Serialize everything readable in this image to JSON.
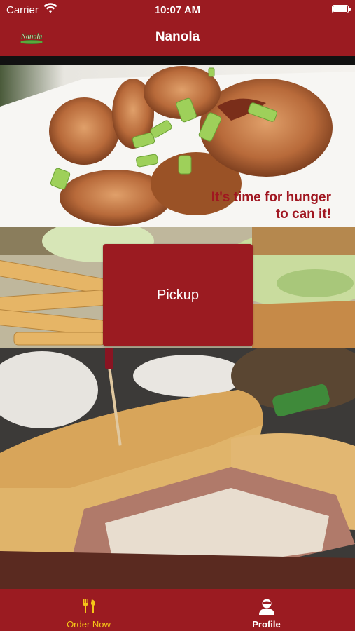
{
  "status_bar": {
    "carrier": "Carrier",
    "time": "10:07 AM"
  },
  "nav": {
    "title": "Nanola",
    "logo_text": "Nanola"
  },
  "hero": {
    "tagline_line1": "It's time for hunger",
    "tagline_line2": "to can it!"
  },
  "pickup": {
    "label": "Pickup"
  },
  "tabs": [
    {
      "label": "Order Now",
      "icon": "utensils-icon",
      "active": true
    },
    {
      "label": "Profile",
      "icon": "user-icon",
      "active": false
    }
  ],
  "colors": {
    "brand_red": "#9b1b21",
    "active_tab": "#f5c518",
    "tagline_red": "#a01620"
  }
}
